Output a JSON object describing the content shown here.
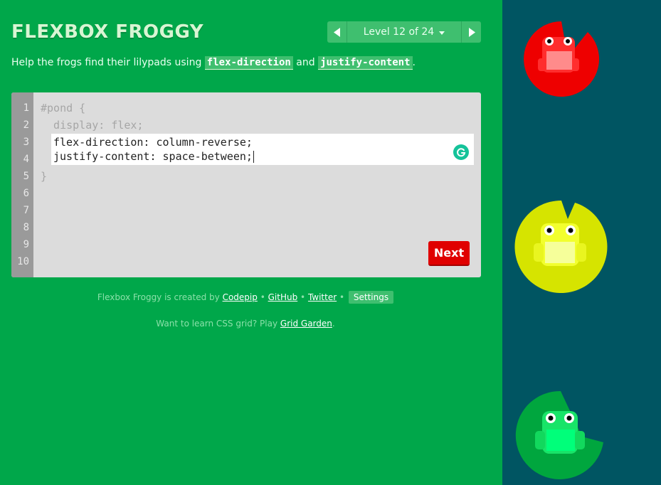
{
  "header": {
    "title": "FLEXBOX FROGGY",
    "level_label": "Level 12 of 24"
  },
  "instructions": {
    "prefix": "Help the frogs find their lilypads using",
    "code1": "flex-direction",
    "joiner": "and",
    "code2": "justify-content",
    "suffix": "."
  },
  "editor": {
    "line_numbers": [
      "1",
      "2",
      "3",
      "4",
      "5",
      "6",
      "7",
      "8",
      "9",
      "10"
    ],
    "static_line1": "#pond {",
    "static_line2": "  display: flex;",
    "static_line5": "}",
    "input_line1": "flex-direction: column-reverse;",
    "input_line2": "justify-content: space-between;",
    "next_label": "Next"
  },
  "footer": {
    "credit_prefix": "Flexbox Froggy is created by",
    "codepip": "Codepip",
    "sep": "•",
    "github": "GitHub",
    "twitter": "Twitter",
    "settings": "Settings",
    "promo_prefix": "Want to learn CSS grid? Play",
    "grid_garden": "Grid Garden",
    "promo_suffix": "."
  },
  "pond": {
    "frogs": [
      {
        "color": "red",
        "pad": "#ee0000",
        "frog": "#ff2e2e"
      },
      {
        "color": "yellow",
        "pad": "#d6e400",
        "frog": "#f2ff2e"
      },
      {
        "color": "green",
        "pad": "#00a63e",
        "frog": "#18e468"
      }
    ]
  },
  "colors": {
    "sidebar_bg": "#00a74a",
    "pond_bg": "#005562",
    "next_button": "#e00000"
  }
}
